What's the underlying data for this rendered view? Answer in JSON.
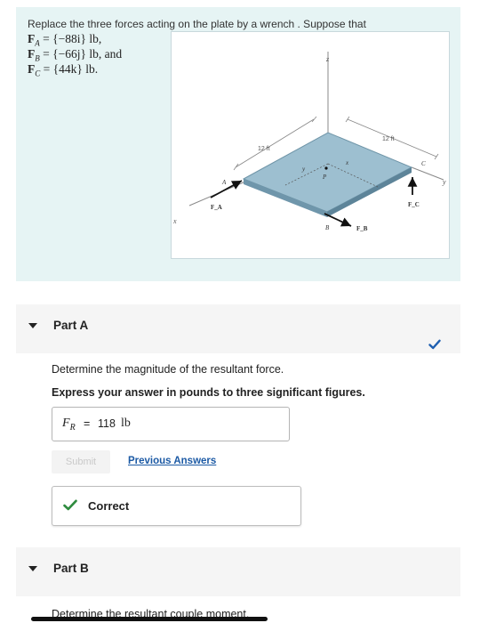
{
  "problem": {
    "intro": "Replace the three forces acting on the plate by a wrench . Suppose that",
    "forces": [
      {
        "sym": "F",
        "sub": "A",
        "eq": " = ",
        "val": "{−88i} lb,"
      },
      {
        "sym": "F",
        "sub": "B",
        "eq": " = ",
        "val": "{−66j} lb, and"
      },
      {
        "sym": "F",
        "sub": "C",
        "eq": " = ",
        "val": "{44k} lb."
      }
    ]
  },
  "figure": {
    "dim_left": "12 ft",
    "dim_right": "12 ft",
    "axis_z": "z",
    "axis_x": "x",
    "axis_y": "y",
    "point_a": "A",
    "point_b": "B",
    "point_c": "C",
    "point_p": "P",
    "plate_x": "x",
    "plate_y": "y",
    "force_a": "F_A",
    "force_b": "F_B",
    "force_c": "F_C",
    "plate_color": "#9dbfd0"
  },
  "part_a": {
    "label": "Part A",
    "instruction": "Determine the magnitude of the resultant force.",
    "hint": "Express your answer in pounds to three significant figures.",
    "answer_var": "F",
    "answer_sub": "R",
    "answer_eq": "=",
    "answer_value": "118",
    "answer_unit": "lb",
    "submit_label": "Submit",
    "previous_answers_label": "Previous Answers",
    "feedback_label": "Correct",
    "status": "correct"
  },
  "part_b": {
    "label": "Part B",
    "instruction": "Determine the resultant couple moment."
  },
  "colors": {
    "accent_link": "#1c5aa5",
    "correct_green": "#2e8b3e",
    "check_blue": "#1f5fb0",
    "problem_bg": "#e6f4f4"
  }
}
